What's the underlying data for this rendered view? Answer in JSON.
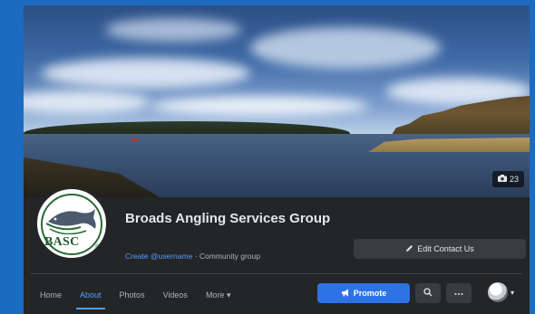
{
  "cover": {
    "photo_count": "23"
  },
  "profile": {
    "logo_text": "BASC",
    "logo_mark": "®",
    "page_name": "Broads Angling Services Group",
    "create_link": "Create @username",
    "category": "Community group"
  },
  "actions": {
    "edit_label": "Edit Contact Us",
    "promote_label": "Promote",
    "search_icon": "search-icon",
    "more_icon": "more-icon"
  },
  "tabs": [
    {
      "label": "Home",
      "active": false
    },
    {
      "label": "About",
      "active": true
    },
    {
      "label": "Photos",
      "active": false
    },
    {
      "label": "Videos",
      "active": false
    },
    {
      "label": "More ▾",
      "active": false
    }
  ],
  "colors": {
    "accent": "#2d73e6",
    "link": "#4f9eff",
    "panel": "#242526",
    "button": "#3a3b3c",
    "frame": "#1b6bc0"
  }
}
